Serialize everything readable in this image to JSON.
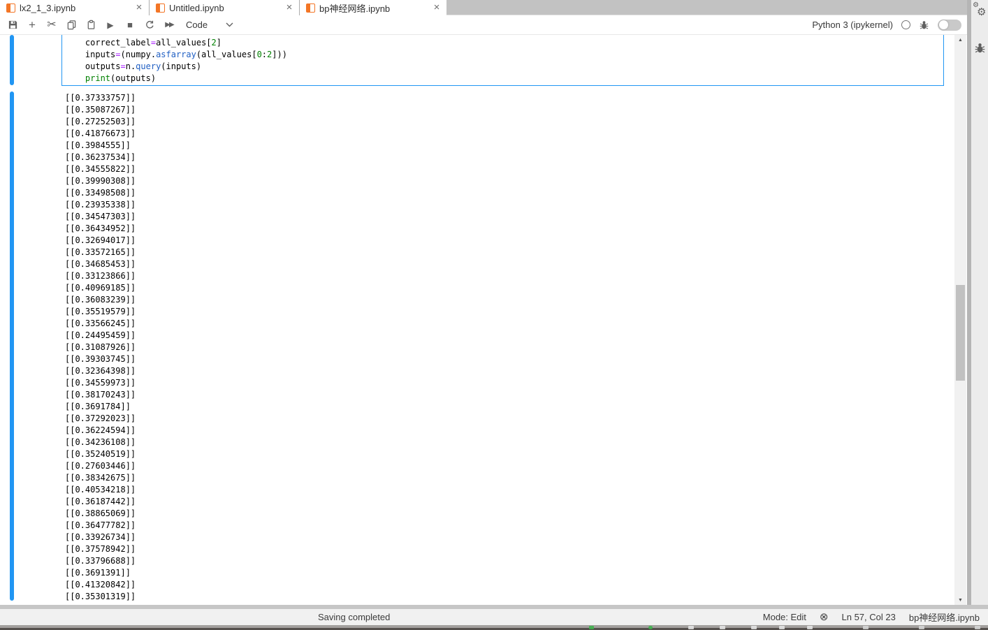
{
  "tabs": [
    {
      "label": "lx2_1_3.ipynb",
      "active": false
    },
    {
      "label": "Untitled.ipynb",
      "active": false
    },
    {
      "label": "bp神经网络.ipynb",
      "active": true
    }
  ],
  "toolbar": {
    "buttons": [
      "save",
      "insert-cell",
      "cut",
      "copy",
      "paste",
      "run",
      "stop",
      "restart-kernel",
      "restart-and-run-all"
    ],
    "cell_type_selected": "Code",
    "kernel_name": "Python 3 (ipykernel)"
  },
  "icons": {
    "plus": "+",
    "scissors": "✂",
    "run": "▶",
    "stop": "■",
    "fast_forward": "▶▶",
    "close": "×",
    "gear": "⚙",
    "circled_x": "⊗",
    "arrow_up": "▲",
    "arrow_down": "▼"
  },
  "code_cell": {
    "lines": [
      [
        {
          "t": "    correct_label",
          "c": "v"
        },
        {
          "t": "=",
          "c": "op"
        },
        {
          "t": "all_values[",
          "c": "v"
        },
        {
          "t": "2",
          "c": "num"
        },
        {
          "t": "]",
          "c": "v"
        }
      ],
      [
        {
          "t": "    inputs",
          "c": "v"
        },
        {
          "t": "=",
          "c": "op"
        },
        {
          "t": "(numpy.",
          "c": "v"
        },
        {
          "t": "asfarray",
          "c": "prop"
        },
        {
          "t": "(all_values[",
          "c": "v"
        },
        {
          "t": "0",
          "c": "num"
        },
        {
          "t": ":",
          "c": "v"
        },
        {
          "t": "2",
          "c": "num"
        },
        {
          "t": "]))",
          "c": "v"
        }
      ],
      [
        {
          "t": "    outputs",
          "c": "v"
        },
        {
          "t": "=",
          "c": "op"
        },
        {
          "t": "n.",
          "c": "v"
        },
        {
          "t": "query",
          "c": "prop"
        },
        {
          "t": "(inputs)",
          "c": "v"
        }
      ],
      [
        {
          "t": "    ",
          "c": "v"
        },
        {
          "t": "print",
          "c": "builtin"
        },
        {
          "t": "(outputs)",
          "c": "v"
        }
      ]
    ]
  },
  "output": {
    "lines": [
      "[[0.37333757]]",
      "[[0.35087267]]",
      "[[0.27252503]]",
      "[[0.41876673]]",
      "[[0.3984555]]",
      "[[0.36237534]]",
      "[[0.34555822]]",
      "[[0.39990308]]",
      "[[0.33498508]]",
      "[[0.23935338]]",
      "[[0.34547303]]",
      "[[0.36434952]]",
      "[[0.32694017]]",
      "[[0.33572165]]",
      "[[0.34685453]]",
      "[[0.33123866]]",
      "[[0.40969185]]",
      "[[0.36083239]]",
      "[[0.35519579]]",
      "[[0.33566245]]",
      "[[0.24495459]]",
      "[[0.31087926]]",
      "[[0.39303745]]",
      "[[0.32364398]]",
      "[[0.34559973]]",
      "[[0.38170243]]",
      "[[0.3691784]]",
      "[[0.37292023]]",
      "[[0.36224594]]",
      "[[0.34236108]]",
      "[[0.35240519]]",
      "[[0.27603446]]",
      "[[0.38342675]]",
      "[[0.40534218]]",
      "[[0.36187442]]",
      "[[0.38865069]]",
      "[[0.36477782]]",
      "[[0.33926734]]",
      "[[0.37578942]]",
      "[[0.33796688]]",
      "[[0.3691391]]",
      "[[0.41320842]]",
      "[[0.35301319]]"
    ]
  },
  "status_bar": {
    "saving_message": "Saving completed",
    "mode": "Mode: Edit",
    "cursor_position": "Ln 57, Col 23",
    "filename": "bp神经网络.ipynb"
  },
  "colors": {
    "accent_blue": "#2196f3",
    "jupyter_orange": "#f37626",
    "tabbar_bg": "#c2c2c2",
    "code_operator": "#aa22ff",
    "code_number": "#008000",
    "code_property": "#2160c4",
    "code_builtin": "#008000",
    "scroll_thumb": "#c1c1c1",
    "taskbar_green": "#3cb44a"
  }
}
